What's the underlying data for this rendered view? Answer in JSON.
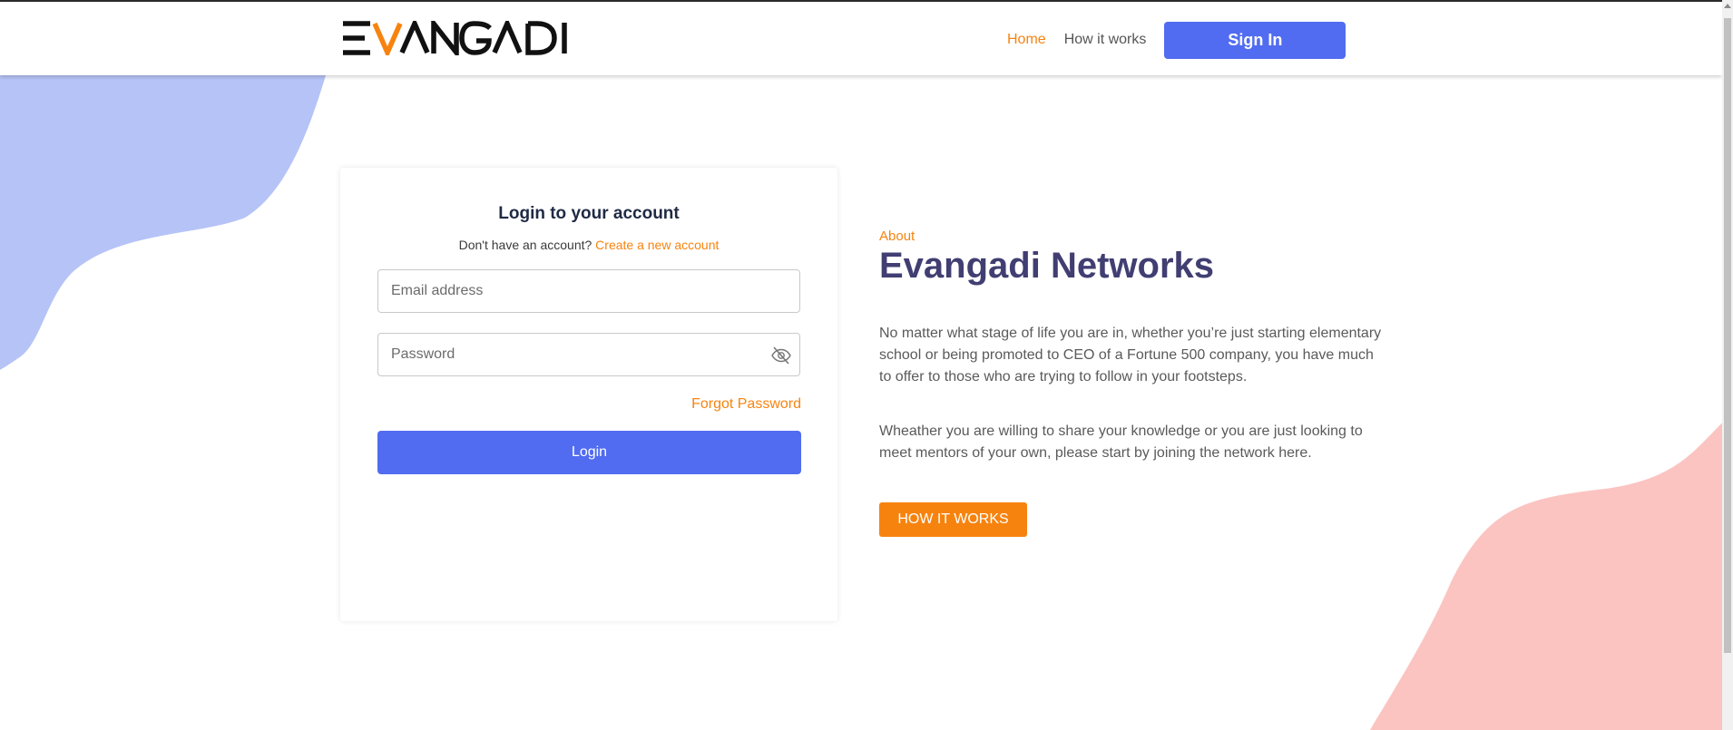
{
  "header": {
    "logo_alt": "EVANGADI",
    "nav": [
      {
        "label": "Home",
        "active": true
      },
      {
        "label": "How it works",
        "active": false
      }
    ],
    "signin_label": "Sign In"
  },
  "login": {
    "title": "Login to your account",
    "no_account_text": "Don't have an account?",
    "create_link": "Create a new account",
    "email_placeholder": "Email address",
    "password_placeholder": "Password",
    "forgot_label": "Forgot Password",
    "login_label": "Login"
  },
  "about": {
    "kicker": "About",
    "title": "Evangadi Networks",
    "p1": "No matter what stage of life you are in, whether you’re just starting elementary school or being promoted to CEO of a Fortune 500 company, you have much to offer to those who are trying to follow in your footsteps.",
    "p2": "Wheather you are willing to share your knowledge or you are just looking to meet mentors of your own, please start by joining the network here.",
    "button_label": "HOW IT WORKS"
  },
  "colors": {
    "accent_orange": "#f7830f",
    "primary_blue": "#516cf0",
    "title_purple": "#413e72",
    "blob_blue": "#b5c3f7",
    "blob_pink": "#fbc4c1"
  },
  "icons": {
    "password_toggle": "eye-slash-icon"
  }
}
